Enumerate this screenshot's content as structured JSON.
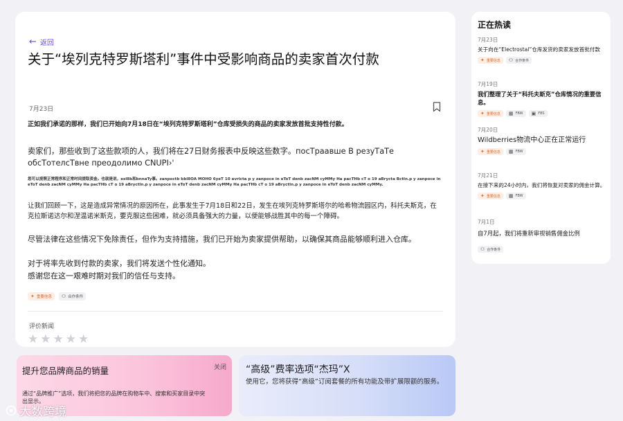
{
  "article": {
    "back_label": "返回",
    "title": "关于“埃列克特罗斯塔利”事件中受影响商品的卖家首次付款",
    "date": "7月23日",
    "paragraphs": [
      "正如我们承诺的那样，我们已开始向7月18日在“埃列克特罗斯塔利”仓库受损失的商品的卖家发放首批支持性付款。",
      "卖家们，那些收到了这些款项的人，我们将在27日财务报表中反映这些数字。посТраавше В резуТаТе обсТотелсТвне преодолимо CNUPI›'",
      "您可以按照正常程序和正常时间提取资金。也就是说，esl8b和bnnaTy事。zanpoctb bbl8OA MOHO 6yeT 10 avricta p y zanpoce in eToT denb zacNM cyMMy Ha pacTHb cT o 19 aBrycta Bctln.p y zanpoce in eToT denb zacNM cyMMy Ha pacTHb cT o 19 aBryctln.p y zanpoce in eToT denb zacNM cyMMy Ha pacTHb cT o 19 aBryctln.p y zanpoce in eToT denb zacNM cyMMy.",
      "让我们回顾一下，这是造成异常情况的原因所在，此事发生于7月18日和22日，发生在埃列克特罗斯塔尔的哈希物流园区内，科托夫斯克，在克拉斯诺达尔和涅温诺米斯克，要克服这些困难，就必须具备强大的力量，以便能够战胜其中的每一个障碍。",
      "尽管法律在这些情况下免除责任，但作为支持措施，我们已开始为卖家提供帮助，以确保其商品能够顺利进入仓库。",
      "对于将率先收到付款的卖家，我们将发送个性化通知。",
      "感谢您在这一艰难时期对我们的信任与支持。"
    ],
    "tags": [
      "重要信息",
      "合作条件"
    ],
    "rate_label": "评价新闻"
  },
  "sidebar": {
    "title": "正在热读",
    "items": [
      {
        "date": "7月23日",
        "headline": "关于向在“Electrostal”仓库发货的卖家发放首批付款",
        "tags": [
          "重要信息",
          "合作条件"
        ]
      },
      {
        "date": "7月19日",
        "headline": "我们整理了关于“科托夫斯克”仓库情况的重要信息。",
        "tags": [
          "重要信息",
          "FBW",
          "FBS"
        ]
      },
      {
        "date": "7月20日",
        "headline": "Wildberries物流中心正在正常运行",
        "tags": [
          "重要信息",
          "FBW"
        ]
      },
      {
        "date": "7月21日",
        "headline": "在接下来的24小时内，我们将恢复对卖家的佣金计算。",
        "tags": [
          "重要信息",
          "FBW"
        ]
      },
      {
        "date": "7月1日",
        "headline": "自7月起，我们将重新审视销售佣金比例",
        "tags": [
          "合作条件"
        ]
      }
    ]
  },
  "promos": {
    "brand": {
      "title": "提升您品牌商品的销量",
      "close_label": "关闭",
      "desc": "通过“品牌推广”选项，我们将把您的品牌在购物车中、搜索和买家目录中突出显示。"
    },
    "premium": {
      "title": "“高级”费率选项“杰玛”X",
      "desc": "使用它，您将获得“高级”订阅套餐的所有功能及带扩展限额的服务。"
    }
  },
  "watermark": {
    "text": "大数跨境"
  },
  "colors": {
    "accent": "#6a4cd6",
    "important": "#e26a2c",
    "star": "#cfcfd6"
  }
}
